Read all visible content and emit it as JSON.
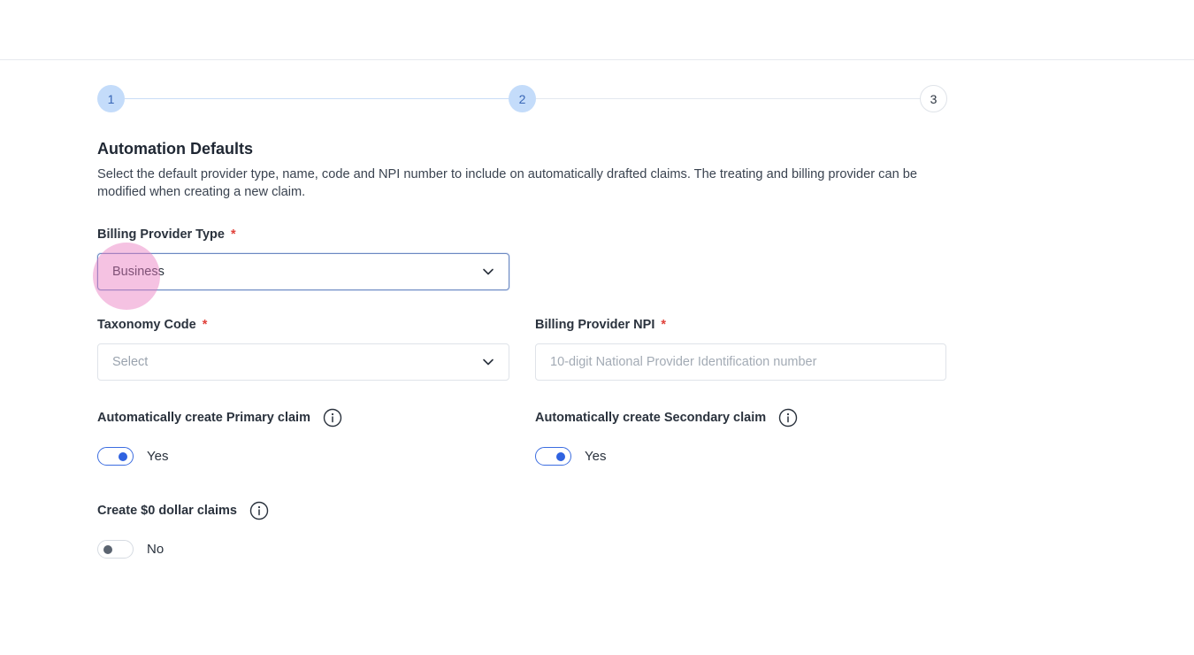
{
  "stepper": {
    "steps": [
      {
        "label": "1",
        "state": "active"
      },
      {
        "label": "2",
        "state": "active"
      },
      {
        "label": "3",
        "state": "inactive"
      }
    ]
  },
  "section": {
    "title": "Automation Defaults",
    "description": "Select the default provider type, name, code and NPI number to include on automatically drafted claims. The treating and billing provider can be modified when creating a new claim."
  },
  "billing_provider_type": {
    "label": "Billing Provider Type",
    "required_mark": "*",
    "value": "Business"
  },
  "taxonomy_code": {
    "label": "Taxonomy Code",
    "required_mark": "*",
    "placeholder": "Select"
  },
  "billing_provider_npi": {
    "label": "Billing Provider NPI",
    "required_mark": "*",
    "placeholder": "10-digit National Provider Identification number"
  },
  "primary_claim": {
    "label": "Automatically create Primary claim",
    "toggle_text": "Yes",
    "enabled": true
  },
  "secondary_claim": {
    "label": "Automatically create Secondary claim",
    "toggle_text": "Yes",
    "enabled": true
  },
  "zero_dollar_claims": {
    "label": "Create $0 dollar claims",
    "toggle_text": "No",
    "enabled": false
  },
  "colors": {
    "accent": "#2f62e0",
    "step_active_bg": "#c4dcfa",
    "required": "#e0413a",
    "click_highlight": "#e878be"
  },
  "icons": {
    "chevron": "chevron-down-icon",
    "info": "info-icon"
  }
}
